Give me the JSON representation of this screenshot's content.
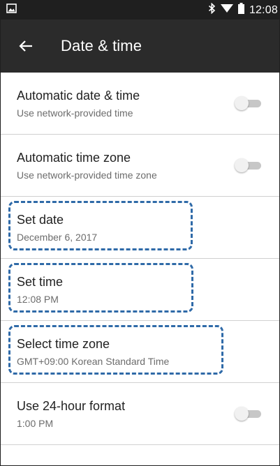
{
  "status_bar": {
    "time": "12:08",
    "icons": [
      "image-notification-icon",
      "bluetooth-icon",
      "wifi-icon",
      "battery-icon"
    ]
  },
  "app_bar": {
    "title": "Date & time",
    "back_icon": "arrow-back-icon"
  },
  "settings": [
    {
      "title": "Automatic date & time",
      "summary": "Use network-provided time",
      "toggle": "off"
    },
    {
      "title": "Automatic time zone",
      "summary": "Use network-provided time zone",
      "toggle": "off"
    },
    {
      "title": "Set date",
      "summary": "December 6, 2017"
    },
    {
      "title": "Set time",
      "summary": "12:08 PM"
    },
    {
      "title": "Select time zone",
      "summary": "GMT+09:00 Korean Standard Time"
    },
    {
      "title": "Use 24-hour format",
      "summary": "1:00 PM",
      "toggle": "off"
    }
  ],
  "colors": {
    "status_bar": "#1f1f1f",
    "app_bar": "#2b2b2b",
    "highlight": "#2f6aa8",
    "switch_track": "#c7c7c7",
    "switch_thumb": "#f1f1f1"
  }
}
